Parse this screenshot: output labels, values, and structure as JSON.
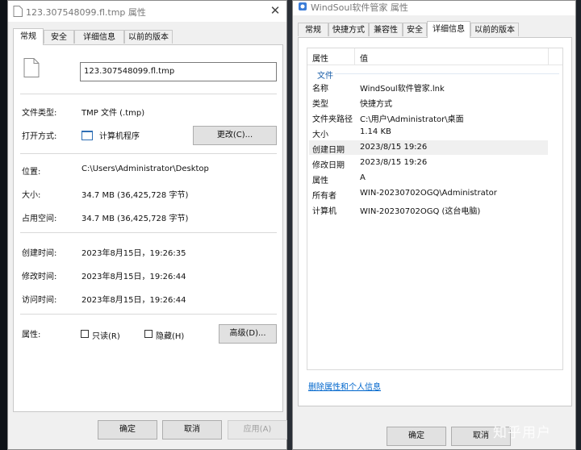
{
  "left_window": {
    "title": "123.307548099.fl.tmp 属性",
    "tabs": [
      "常规",
      "安全",
      "详细信息",
      "以前的版本"
    ],
    "filename": "123.307548099.fl.tmp",
    "file_type_label": "文件类型:",
    "file_type_value": "TMP 文件 (.tmp)",
    "open_with_label": "打开方式:",
    "open_with_value": "计算机程序",
    "change_button": "更改(C)...",
    "location_label": "位置:",
    "location_value": "C:\\Users\\Administrator\\Desktop",
    "size_label": "大小:",
    "size_value": "34.7 MB (36,425,728 字节)",
    "size_on_disk_label": "占用空间:",
    "size_on_disk_value": "34.7 MB (36,425,728 字节)",
    "created_label": "创建时间:",
    "created_value": "2023年8月15日，19:26:35",
    "modified_label": "修改时间:",
    "modified_value": "2023年8月15日，19:26:44",
    "accessed_label": "访问时间:",
    "accessed_value": "2023年8月15日，19:26:44",
    "attributes_label": "属性:",
    "readonly_label": "只读(R)",
    "hidden_label": "隐藏(H)",
    "advanced_button": "高级(D)...",
    "ok_button": "确定",
    "cancel_button": "取消",
    "apply_button": "应用(A)"
  },
  "right_window": {
    "title": "WindSoul软件管家 属性",
    "tabs": [
      "常规",
      "快捷方式",
      "兼容性",
      "安全",
      "详细信息",
      "以前的版本"
    ],
    "header_property": "属性",
    "header_value": "值",
    "section": "文件",
    "rows": [
      {
        "k": "名称",
        "v": "WindSoul软件管家.lnk"
      },
      {
        "k": "类型",
        "v": "快捷方式"
      },
      {
        "k": "文件夹路径",
        "v": "C:\\用户\\Administrator\\桌面"
      },
      {
        "k": "大小",
        "v": "1.14 KB"
      },
      {
        "k": "创建日期",
        "v": "2023/8/15 19:26"
      },
      {
        "k": "修改日期",
        "v": "2023/8/15 19:26"
      },
      {
        "k": "属性",
        "v": "A"
      },
      {
        "k": "所有者",
        "v": "WIN-20230702OGQ\\Administrator"
      },
      {
        "k": "计算机",
        "v": "WIN-20230702OGQ (这台电脑)"
      }
    ],
    "remove_link": "删除属性和个人信息",
    "ok_button": "确定",
    "cancel_button": "取消"
  },
  "watermark": "知乎用户",
  "colors": {
    "link": "#0066cc",
    "section": "#1a5ea8",
    "selected_row": "#f0f0f0"
  }
}
